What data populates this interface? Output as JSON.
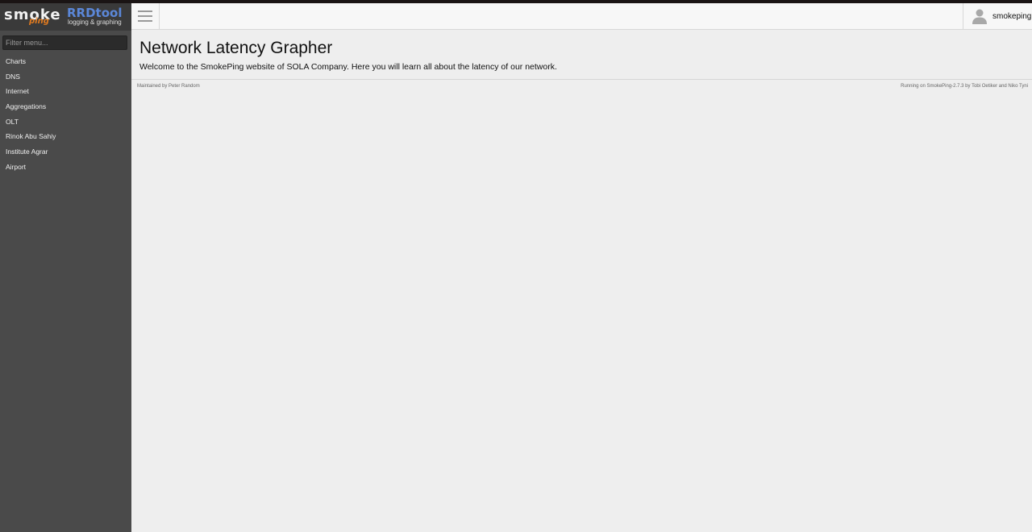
{
  "logo": {
    "smoke": "smoke",
    "ping": "ping",
    "rrdtool": "RRDtool",
    "rrdtool_sub": "logging & graphing"
  },
  "sidebar": {
    "filter_placeholder": "Filter menu...",
    "items": [
      {
        "label": "Charts"
      },
      {
        "label": "DNS"
      },
      {
        "label": "Internet"
      },
      {
        "label": "Aggregations"
      },
      {
        "label": "OLT"
      },
      {
        "label": "Rinok Abu Sahiy"
      },
      {
        "label": "Institute Agrar"
      },
      {
        "label": "Airport"
      }
    ]
  },
  "header": {
    "menu_icon": "hamburger-icon",
    "user_icon": "user-icon",
    "username": "smokeping"
  },
  "main": {
    "title": "Network Latency Grapher",
    "welcome": "Welcome to the SmokePing website of SOLA Company. Here you will learn all about the latency of our network."
  },
  "footer": {
    "maintained_by": "Maintained by Peter Random",
    "running_on": "Running on SmokePing-2.7.3 by Tobi Oetiker and Niko Tyni"
  },
  "colors": {
    "sidebar_bg": "#4a4a4a",
    "logo_bg": "#3a3a3a",
    "page_bg": "#eeeeee",
    "rrdtool_blue": "#5b87d8",
    "ping_orange": "#e07a1f"
  }
}
